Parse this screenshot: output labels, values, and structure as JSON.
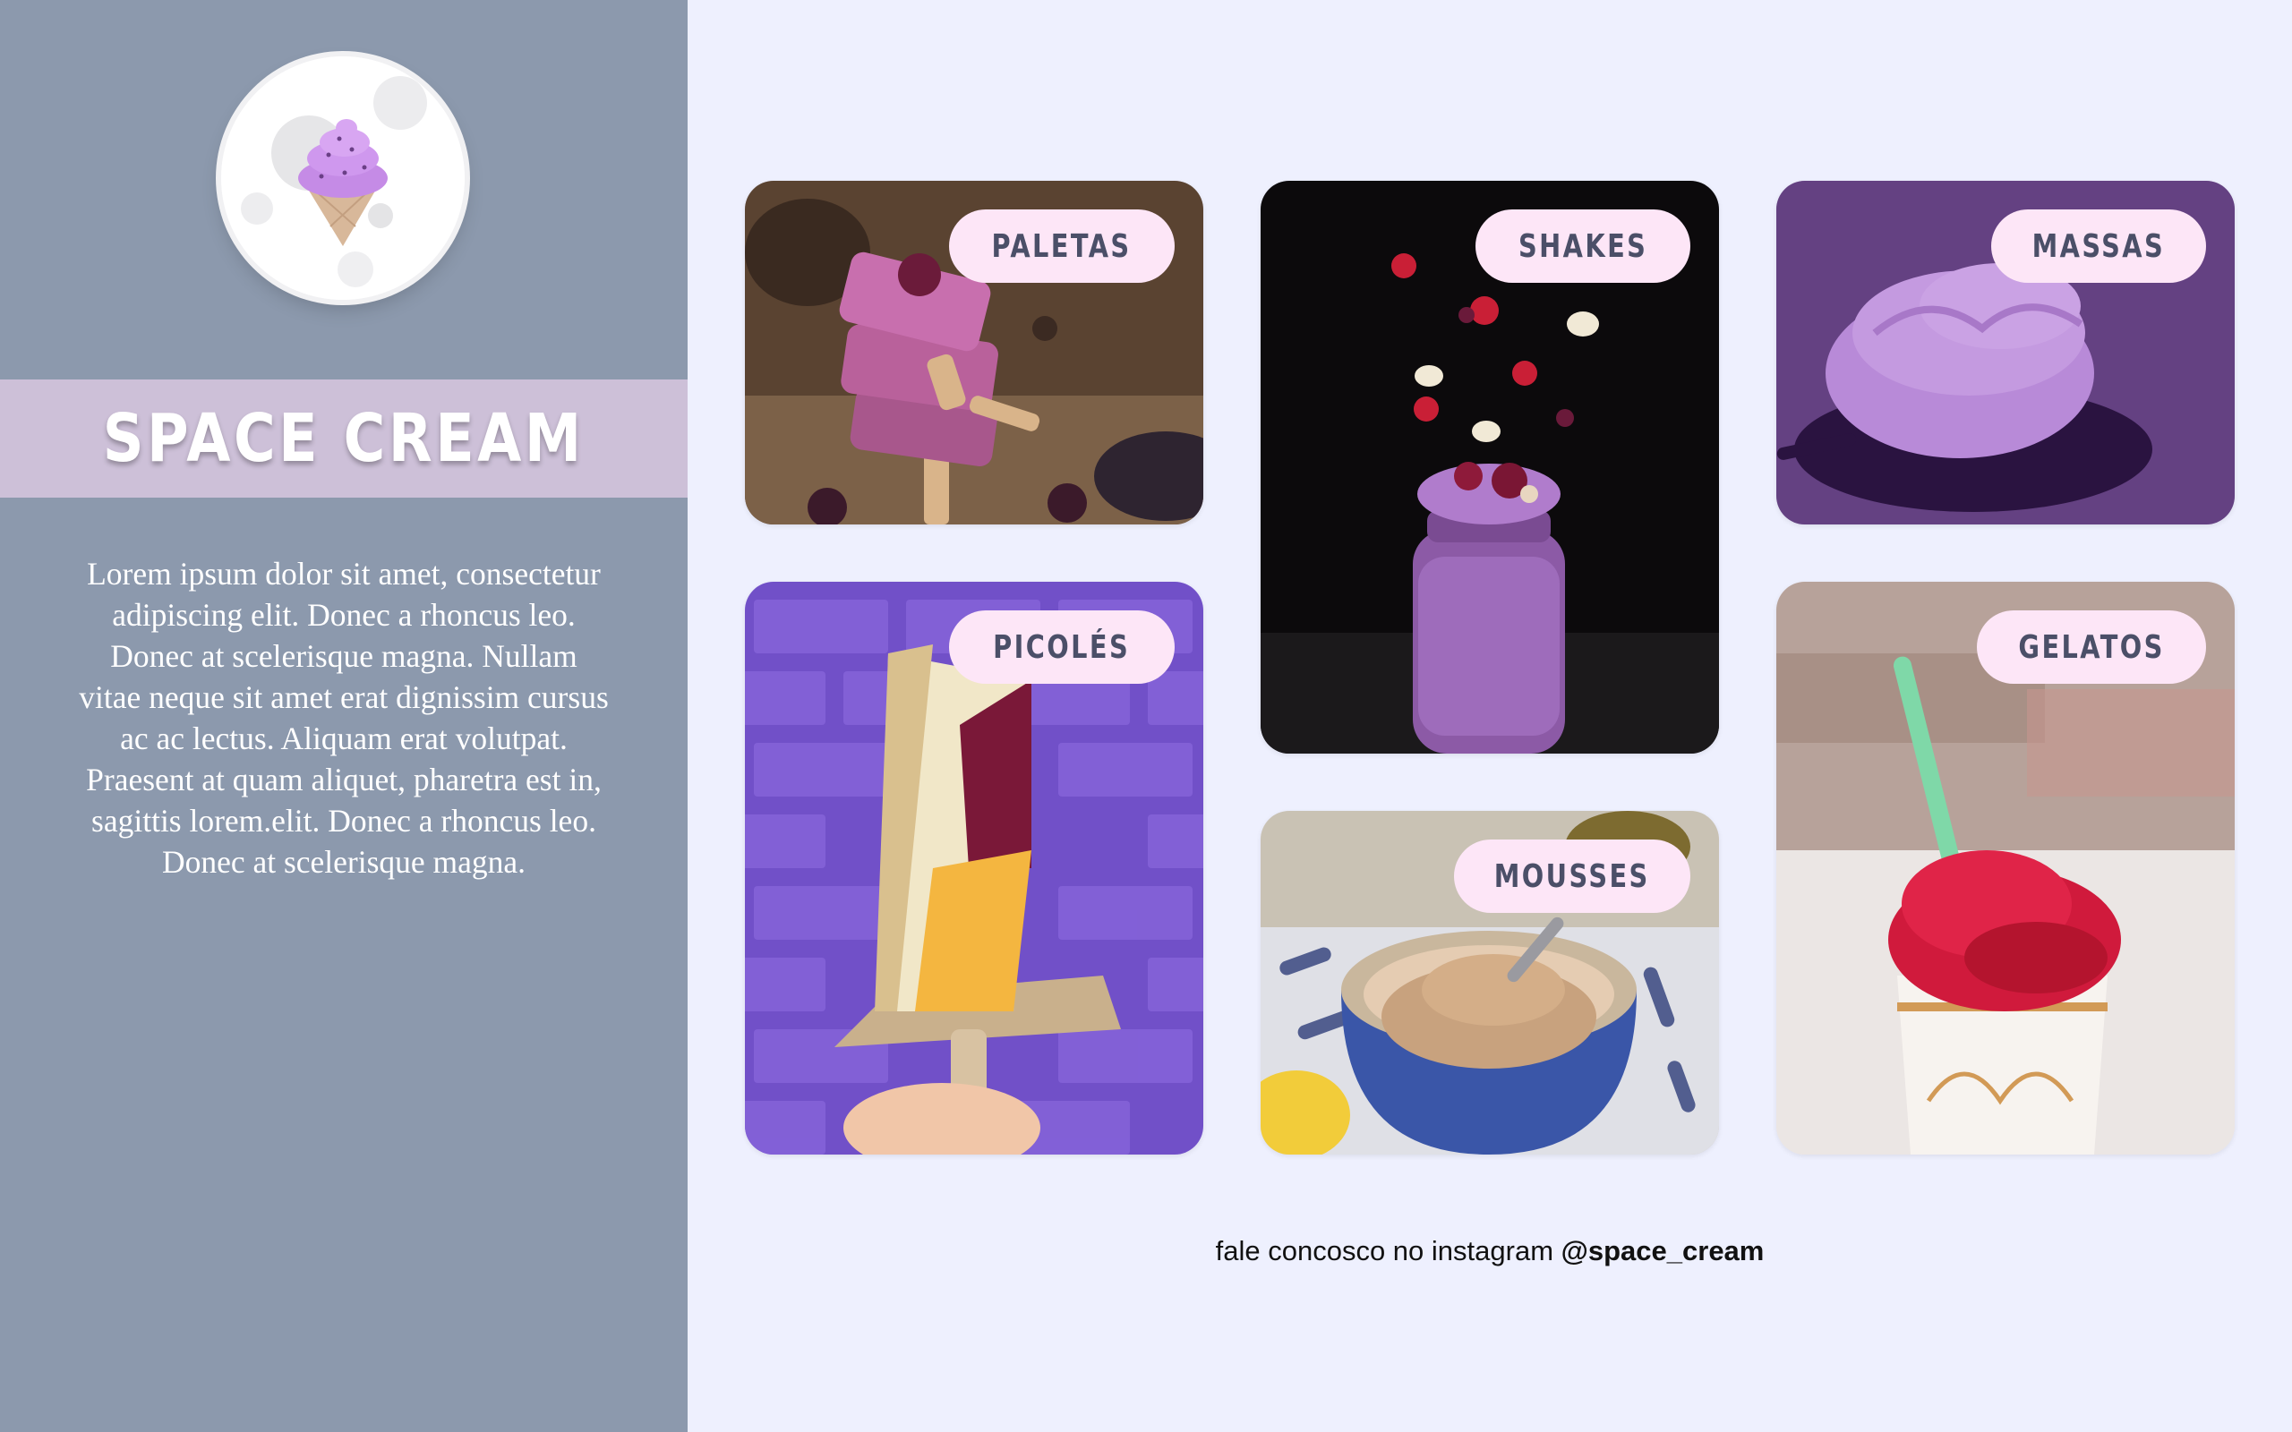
{
  "brand": {
    "name": "SPACE CREAM",
    "description": "Lorem ipsum dolor sit amet, consectetur adipiscing elit. Donec a rhoncus leo. Donec at scelerisque magna. Nullam vitae neque sit amet erat dignissim cursus ac ac lectus. Aliquam erat volutpat. Praesent at quam aliquet, pharetra est in, sagittis lorem.elit. Donec a rhoncus leo. Donec at scelerisque magna."
  },
  "categories": {
    "paletas": "PALETAS",
    "shakes": "SHAKES",
    "massas": "MASSAS",
    "picoles": "PICOLÉS",
    "mousses": "MOUSSES",
    "gelatos": "GELATOS"
  },
  "footer": {
    "text": "fale concosco no instagram",
    "handle": "@space_cream"
  },
  "colors": {
    "sidebar": "#8c99ad",
    "brand_band": "#cdc0d8",
    "page_background": "#eef0fe",
    "pill_background": "#fde6f7",
    "pill_text": "#4b4f68"
  },
  "icons": {
    "logo": "ice-cream-cone-icon"
  }
}
